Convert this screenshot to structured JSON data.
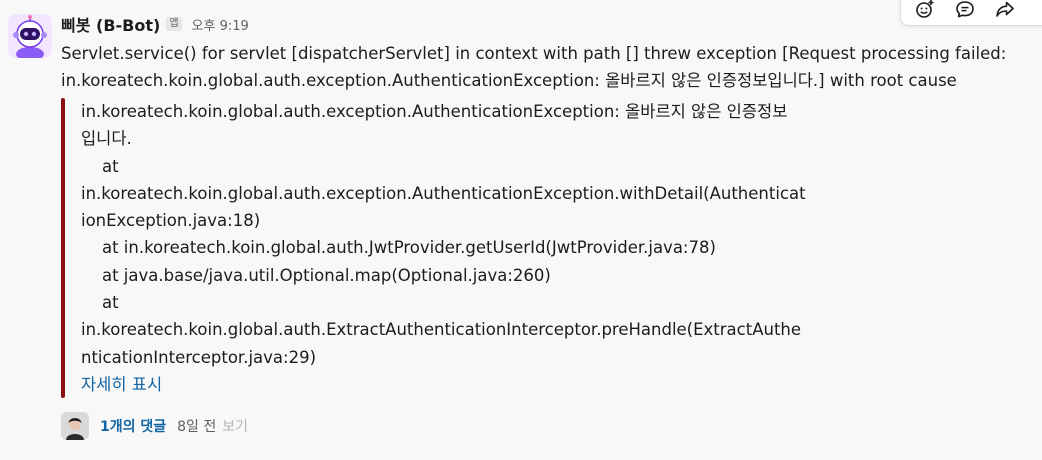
{
  "message": {
    "sender": "삐봇 (B-Bot)",
    "app_badge": "앱",
    "timestamp": "오후 9:19",
    "text": "Servlet.service() for servlet [dispatcherServlet] in context with path [] threw exception [Request processing failed: in.koreatech.koin.global.auth.exception.AuthenticationException: 올바르지 않은 인증정보입니다.] with root cause"
  },
  "attachment": {
    "accent_color": "#8b0e12",
    "lines": [
      "in.koreatech.koin.global.auth.exception.AuthenticationException: 올바르지 않은 인증정보",
      "입니다.",
      "    at",
      "in.koreatech.koin.global.auth.exception.AuthenticationException.withDetail(Authenticat",
      "ionException.java:18)",
      "    at in.koreatech.koin.global.auth.JwtProvider.getUserId(JwtProvider.java:78)",
      "    at java.base/java.util.Optional.map(Optional.java:260)",
      "    at",
      "in.koreatech.koin.global.auth.ExtractAuthenticationInterceptor.preHandle(ExtractAuthe",
      "nticationInterceptor.java:29)"
    ],
    "show_more": "자세히 표시"
  },
  "thread": {
    "reply_count": "1개의 댓글",
    "time": "8일 전",
    "view": "보기"
  },
  "toolbar": {
    "icons": [
      "add-reaction-icon",
      "reply-in-thread-icon",
      "share-icon"
    ]
  },
  "colors": {
    "link": "#1264a3",
    "text": "#1d1c1d",
    "muted": "#616061",
    "background": "#f8f8f8"
  }
}
